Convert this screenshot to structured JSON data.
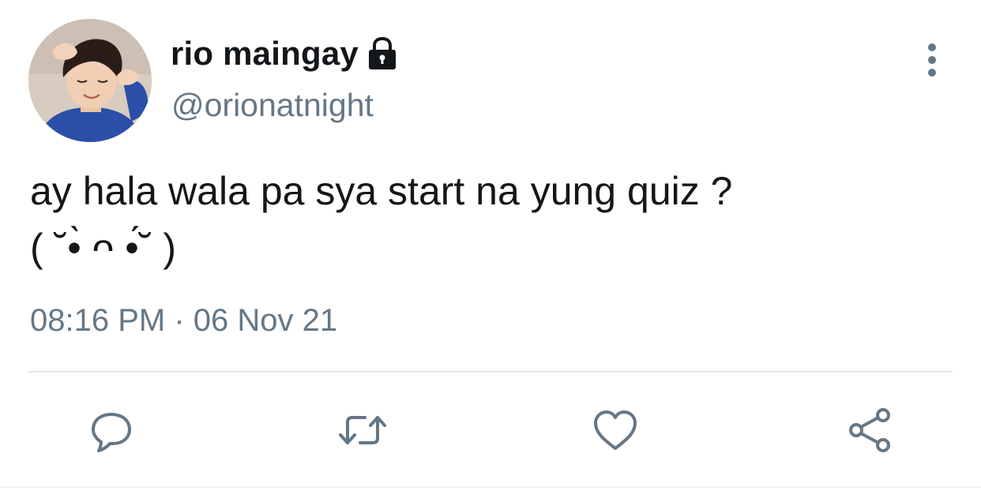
{
  "tweet": {
    "display_name": "rio maingay",
    "handle": "@orionatnight",
    "text": "ay hala wala pa sya start na yung quiz ?\n( ˘•̀ ᴖ •́˘ )",
    "time": "08:16 PM",
    "separator": "·",
    "date": "06 Nov 21",
    "protected_icon": "lock-icon",
    "more_icon": "more-vertical-icon"
  },
  "actions": [
    {
      "name": "reply",
      "icon": "reply-icon"
    },
    {
      "name": "retweet",
      "icon": "retweet-icon"
    },
    {
      "name": "like",
      "icon": "heart-icon"
    },
    {
      "name": "share",
      "icon": "share-icon"
    }
  ],
  "colors": {
    "text": "#14171a",
    "secondary": "#657786",
    "divider": "#e1e8ed"
  }
}
